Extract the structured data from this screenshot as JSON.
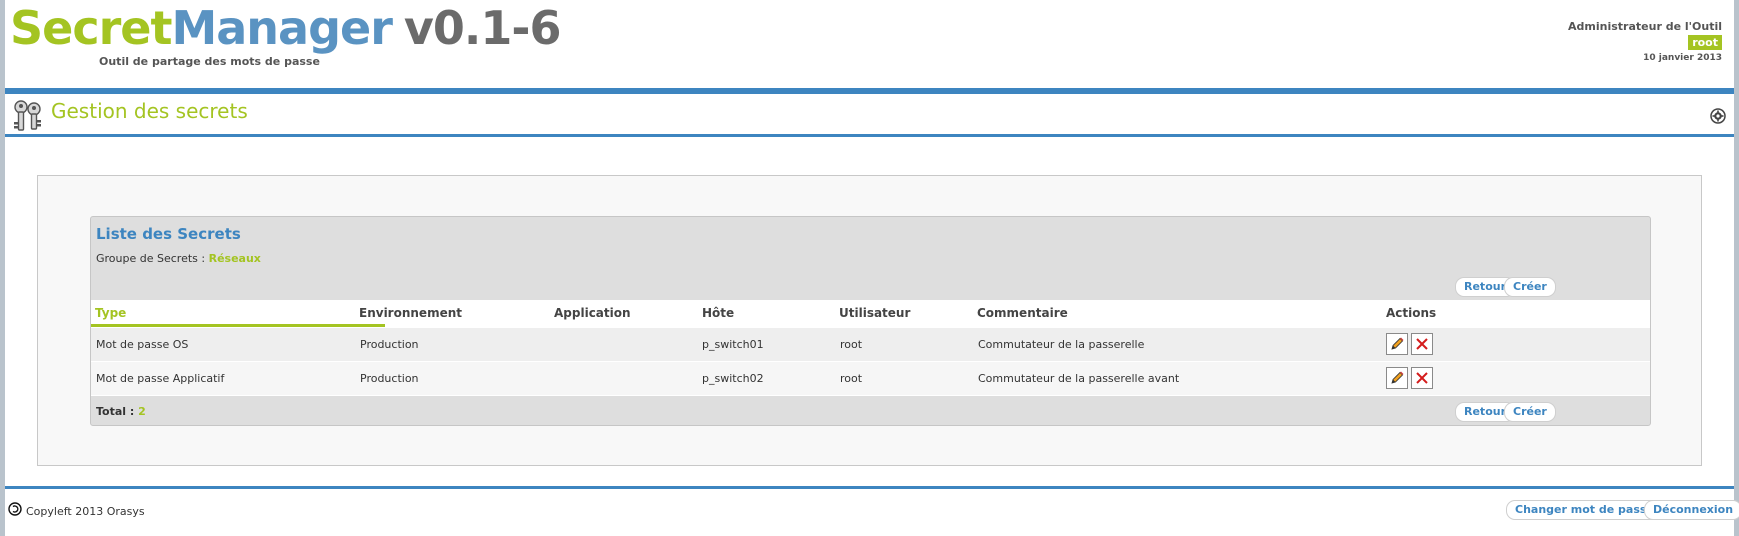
{
  "header": {
    "logo_secret": "Secret",
    "logo_manager": "Manager",
    "logo_version": "v0.1-6",
    "tagline": "Outil de partage des mots de passe",
    "user_role": "Administrateur de l'Outil",
    "user_name": "root",
    "date": "10 janvier 2013"
  },
  "titlebar": {
    "title": "Gestion des secrets",
    "keys_icon": "keys-icon",
    "gear_icon": "gear-icon"
  },
  "list": {
    "title": "Liste des Secrets",
    "group_label": "Groupe de Secrets :",
    "group_value": "Réseaux",
    "btn_back": "Retour",
    "btn_create": "Créer",
    "columns": [
      "Type",
      "Environnement",
      "Application",
      "Hôte",
      "Utilisateur",
      "Commentaire",
      "Actions"
    ],
    "rows": [
      {
        "type": "Mot de passe OS",
        "env": "Production",
        "app": "",
        "host": "p_switch01",
        "user": "root",
        "comment": "Commutateur de la passerelle"
      },
      {
        "type": "Mot de passe Applicatif",
        "env": "Production",
        "app": "",
        "host": "p_switch02",
        "user": "root",
        "comment": "Commutateur de la passerelle avant"
      }
    ],
    "total_label": "Total :",
    "total_value": "2"
  },
  "footer": {
    "copyleft": "Copyleft 2013 Orasys",
    "btn_change_password": "Changer mot de passe",
    "btn_logout": "Déconnexion"
  },
  "colors": {
    "accent_green": "#a4c422",
    "accent_blue": "#3d85c0"
  }
}
